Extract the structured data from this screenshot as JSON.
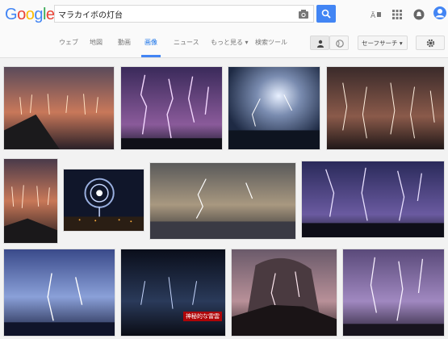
{
  "logo": "Google",
  "colors": {
    "g1": "#4285f4",
    "o1": "#ea4335",
    "o2": "#fbbc05",
    "g2": "#4285f4",
    "l": "#34a853",
    "e": "#ea4335"
  },
  "search": {
    "query": "マラカイボの灯台"
  },
  "header_icons": [
    "apps-icon",
    "grid-icon",
    "notifications-icon",
    "account-avatar"
  ],
  "tabs": [
    {
      "label": "ウェブ"
    },
    {
      "label": "地図"
    },
    {
      "label": "動画"
    },
    {
      "label": "画像"
    },
    {
      "label": "ニュース"
    },
    {
      "label": "もっと見る ▾"
    },
    {
      "label": "検索ツール"
    }
  ],
  "safe_search": "セーフサーチ ▾",
  "images": [
    {
      "alt": "lightning over lake at dusk"
    },
    {
      "alt": "lightning bolts over coastline"
    },
    {
      "alt": "storm cloud with lightning over water"
    },
    {
      "alt": "lightning strikes at night"
    },
    {
      "alt": "lightning on horizon"
    },
    {
      "alt": "spiral light phenomenon"
    },
    {
      "alt": "lightning in clouds over lake"
    },
    {
      "alt": "purple lightning over city"
    },
    {
      "alt": "lightning storm over water"
    },
    {
      "alt": "dark storm with lightning"
    },
    {
      "alt": "lightning in volcanic cloud"
    },
    {
      "alt": "purple sky lightning"
    }
  ],
  "overlay": "神秘的な雷雲"
}
